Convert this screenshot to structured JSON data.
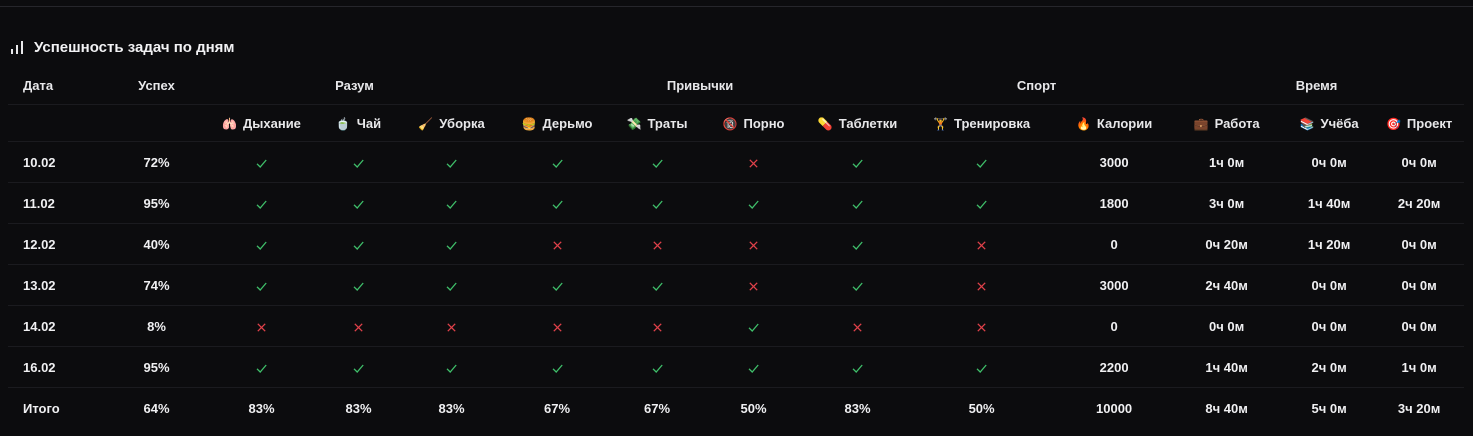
{
  "title": "Успешность задач по дням",
  "headers": {
    "date": "Дата",
    "success": "Успех",
    "groups": [
      "Разум",
      "Привычки",
      "Спорт",
      "Время"
    ],
    "columns": [
      {
        "icon": "lungs-icon",
        "emoji": "🫁",
        "label": "Дыхание"
      },
      {
        "icon": "tea-icon",
        "emoji": "🍵",
        "label": "Чай"
      },
      {
        "icon": "broom-icon",
        "emoji": "🧹",
        "label": "Уборка"
      },
      {
        "icon": "burger-icon",
        "emoji": "🍔",
        "label": "Дерьмо"
      },
      {
        "icon": "money-icon",
        "emoji": "💸",
        "label": "Траты"
      },
      {
        "icon": "no-18-icon",
        "emoji": "🔞",
        "label": "Порно"
      },
      {
        "icon": "pill-icon",
        "emoji": "💊",
        "label": "Таблетки"
      },
      {
        "icon": "weightlifter-icon",
        "emoji": "🏋",
        "label": "Тренировка"
      },
      {
        "icon": "fire-icon",
        "emoji": "🔥",
        "label": "Калории"
      },
      {
        "icon": "briefcase-icon",
        "emoji": "💼",
        "label": "Работа"
      },
      {
        "icon": "books-icon",
        "emoji": "📚",
        "label": "Учёба"
      },
      {
        "icon": "target-icon",
        "emoji": "🎯",
        "label": "Проект"
      }
    ]
  },
  "rows": [
    {
      "date": "10.02",
      "success": "72%",
      "checks": [
        true,
        true,
        true,
        true,
        true,
        false,
        true,
        true
      ],
      "calories": "3000",
      "work": "1ч 0м",
      "study": "0ч 0м",
      "project": "0ч 0м"
    },
    {
      "date": "11.02",
      "success": "95%",
      "checks": [
        true,
        true,
        true,
        true,
        true,
        true,
        true,
        true
      ],
      "calories": "1800",
      "work": "3ч 0м",
      "study": "1ч 40м",
      "project": "2ч 20м"
    },
    {
      "date": "12.02",
      "success": "40%",
      "checks": [
        true,
        true,
        true,
        false,
        false,
        false,
        true,
        false
      ],
      "calories": "0",
      "work": "0ч 20м",
      "study": "1ч 20м",
      "project": "0ч 0м"
    },
    {
      "date": "13.02",
      "success": "74%",
      "checks": [
        true,
        true,
        true,
        true,
        true,
        false,
        true,
        false
      ],
      "calories": "3000",
      "work": "2ч 40м",
      "study": "0ч 0м",
      "project": "0ч 0м"
    },
    {
      "date": "14.02",
      "success": "8%",
      "checks": [
        false,
        false,
        false,
        false,
        false,
        true,
        false,
        false
      ],
      "calories": "0",
      "work": "0ч 0м",
      "study": "0ч 0м",
      "project": "0ч 0м"
    },
    {
      "date": "16.02",
      "success": "95%",
      "checks": [
        true,
        true,
        true,
        true,
        true,
        true,
        true,
        true
      ],
      "calories": "2200",
      "work": "1ч 40м",
      "study": "2ч 0м",
      "project": "1ч 0м"
    }
  ],
  "total": {
    "label": "Итого",
    "success": "64%",
    "checks": [
      "83%",
      "83%",
      "83%",
      "67%",
      "67%",
      "50%",
      "83%",
      "50%"
    ],
    "calories": "10000",
    "work": "8ч 40м",
    "study": "5ч 0м",
    "project": "3ч 20м"
  },
  "colors": {
    "ok": "#3fbf6a",
    "bad": "#e0414a",
    "background": "#0c0c0e"
  }
}
